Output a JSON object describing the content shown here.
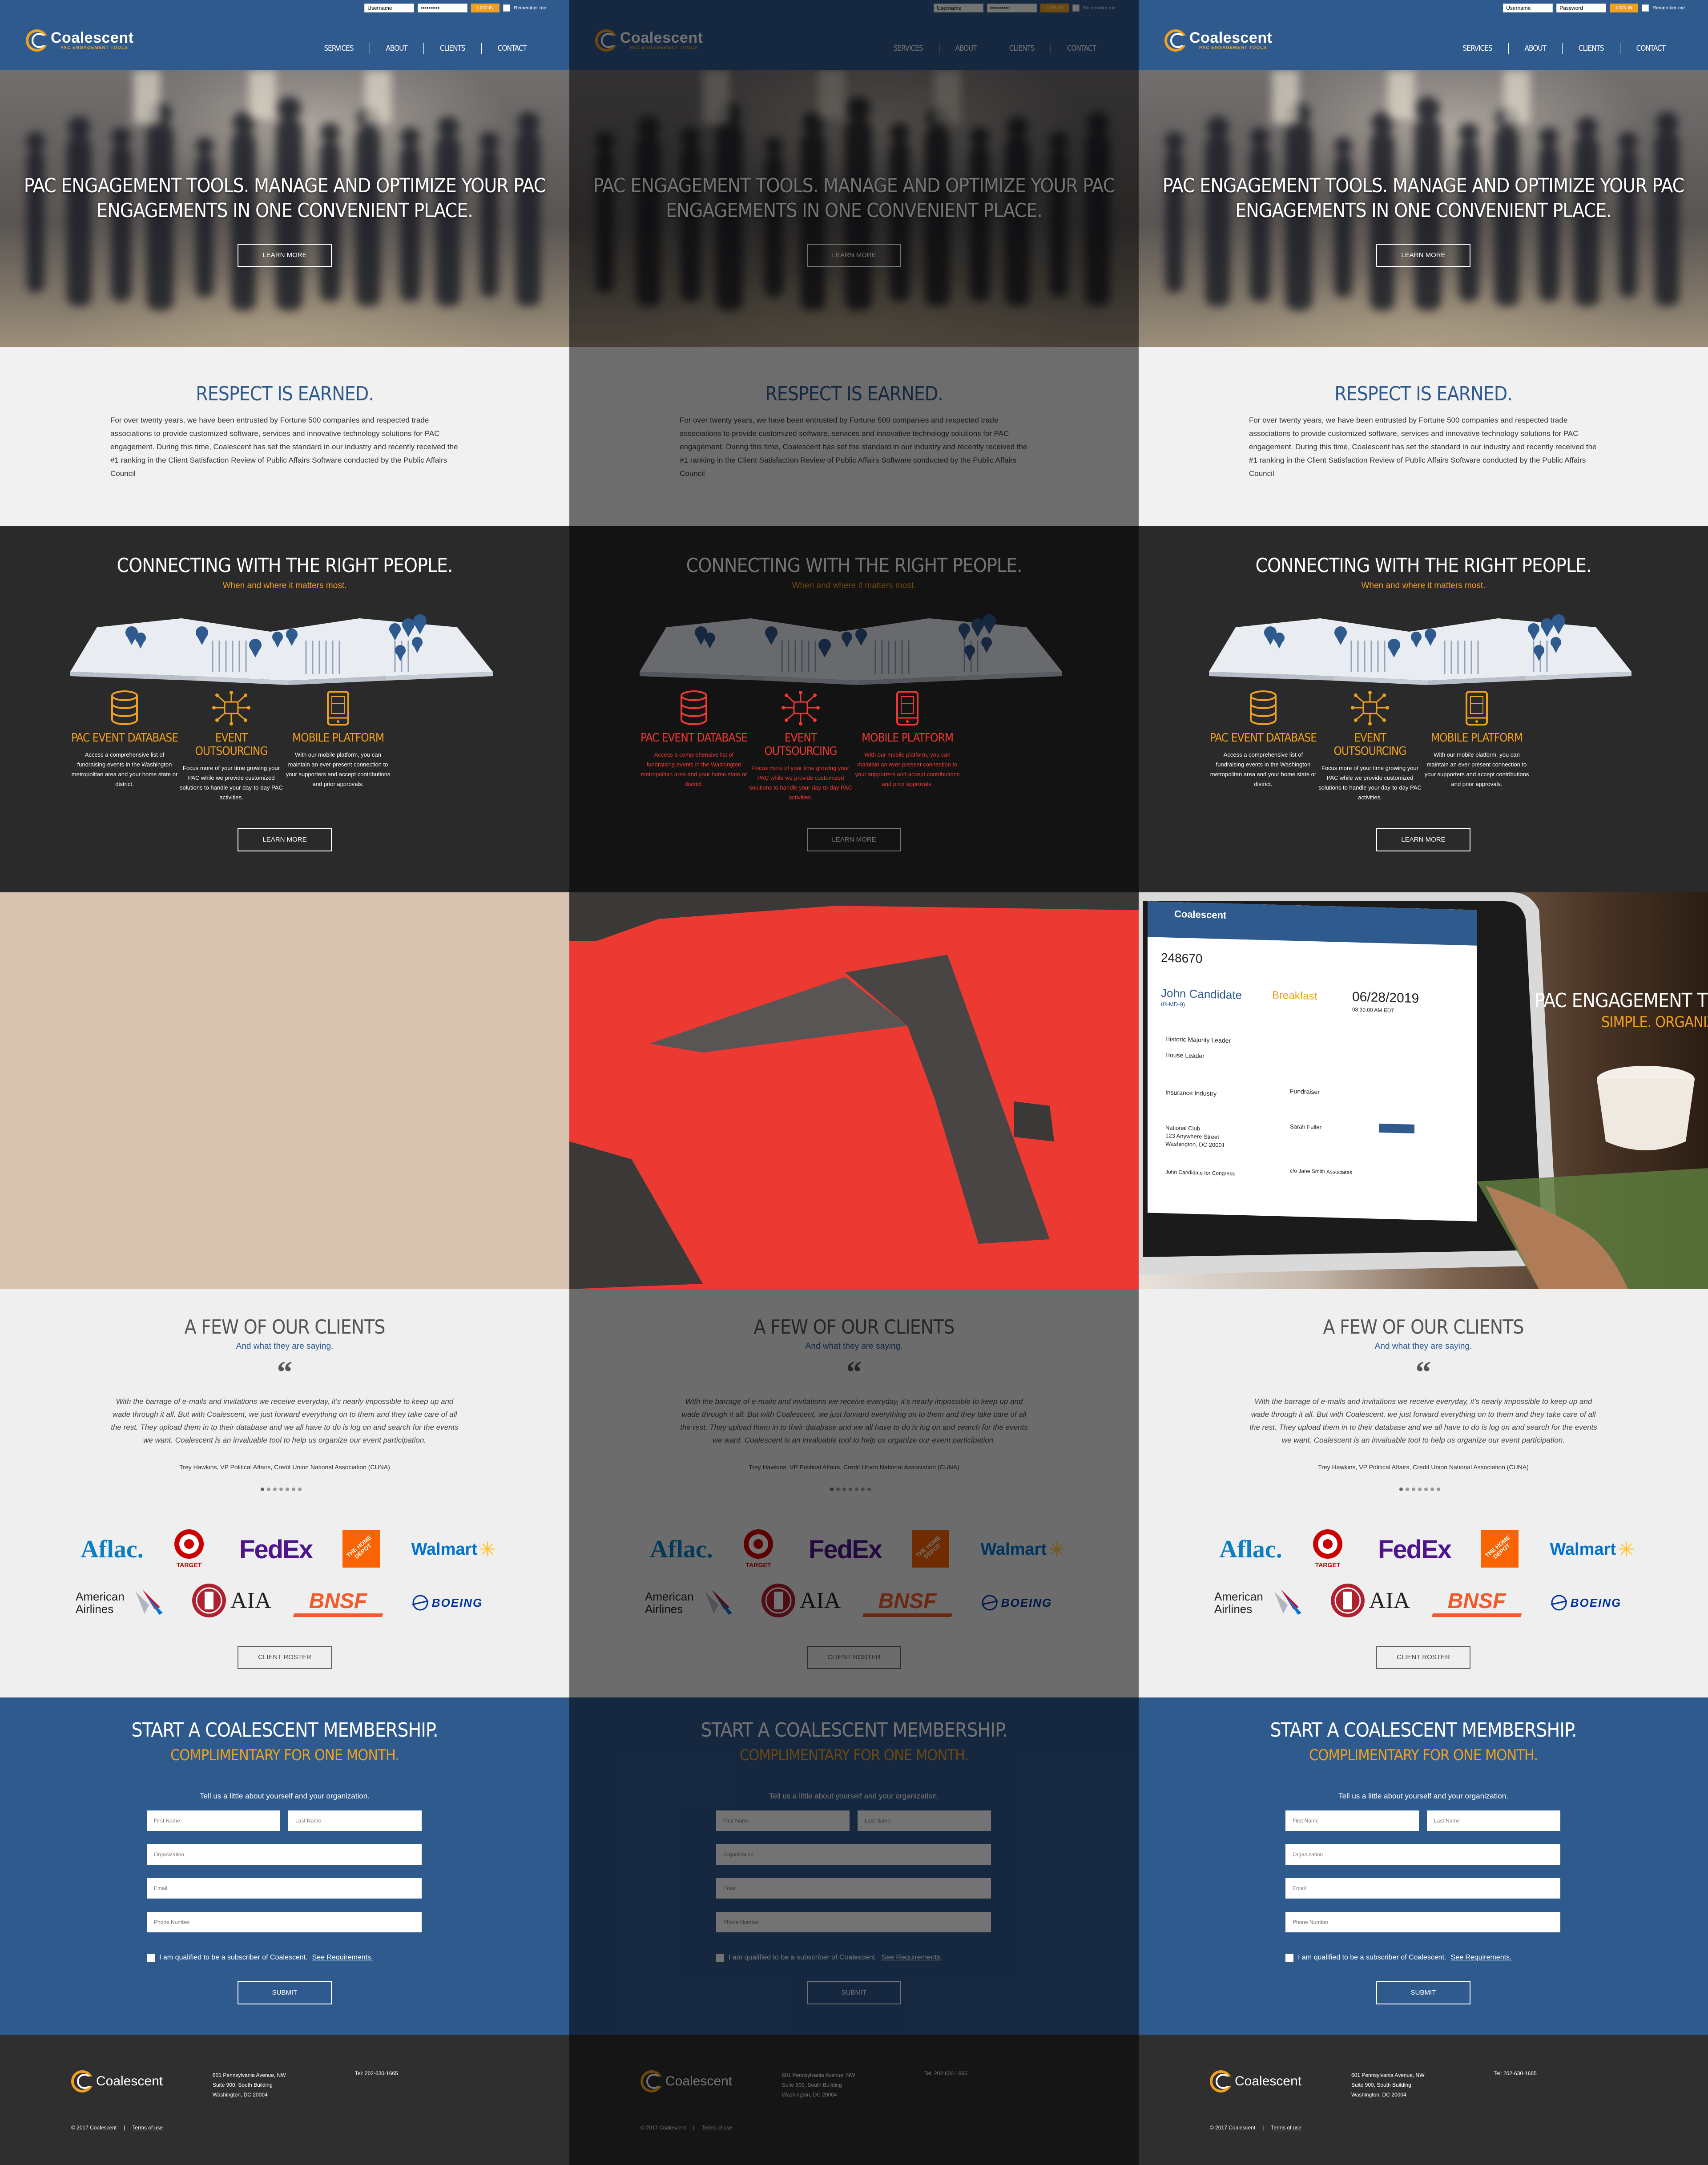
{
  "colors": {
    "brand_blue": "#2f5a8e",
    "accent_orange": "#f0a020",
    "dark": "#2a2a2a",
    "light": "#f1f1f1",
    "highlight_red": "#ec3a32"
  },
  "login": {
    "username_value": "Username",
    "password_value": "••••••••••",
    "password_placeholder": "Password",
    "login_button": "LOG IN",
    "remember": "Remember me"
  },
  "brand": {
    "name": "Coalescent",
    "tagline": "PAC ENGAGEMENT TOOLS"
  },
  "nav": {
    "items": [
      "SERVICES",
      "ABOUT",
      "CLIENTS",
      "CONTACT"
    ]
  },
  "hero": {
    "headline": "PAC ENGAGEMENT TOOLS. MANAGE AND OPTIMIZE YOUR PAC ENGAGEMENTS IN ONE CONVENIENT PLACE.",
    "button": "LEARN MORE"
  },
  "respect": {
    "title": "RESPECT IS EARNED.",
    "body": "For over twenty years, we have been entrusted by Fortune 500 companies and respected trade associations to provide customized software, services and innovative technology solutions for PAC engagement. During this time, Coalescent has set the standard in our industry and recently received the #1 ranking in the Client Satisfaction Review of Public Affairs Software conducted by the Public Affairs Council"
  },
  "connect": {
    "title": "CONNECTING WITH THE RIGHT PEOPLE.",
    "tagline": "When and where it matters most.",
    "features": [
      {
        "title": "PAC EVENT DATABASE",
        "icon": "database-icon",
        "desc": "Access a comprehensive list of fundraising events in the Washington metropolitan area and your home state or district."
      },
      {
        "title": "EVENT OUTSOURCING",
        "icon": "network-icon",
        "desc": "Focus more of your time growing your PAC while we provide customized solutions to handle your day-to-day PAC activities."
      },
      {
        "title": "MOBILE PLATFORM",
        "icon": "mobile-icon",
        "desc": "With our mobile platform, you can maintain an ever-present connection to your supporters and accept contributions and prior approvals."
      }
    ],
    "button": "LEARN MORE"
  },
  "laptop": {
    "headline": "PAC ENGAGEMENT TOOLS",
    "subheadline": "SIMPLE. ORGANIZED",
    "screen": {
      "brand": "Coalescent",
      "event_id": "248670",
      "candidate": "John Candidate",
      "district": "(R-MD-9)",
      "event_type": "Breakfast",
      "date": "06/28/2019",
      "time": "08:30:00 AM EDT",
      "role1": "Historic Majority Leader",
      "role2": "House Leader",
      "industry": "Insurance Industry",
      "type": "Fundraiser",
      "venue": "National Club",
      "venue_addr1": "123 Anywhere Street",
      "venue_addr2": "Washington, DC 20001",
      "contact": "Sarah Fuller",
      "committee": "John Candidate for Congress",
      "host": "c/o Jane Smith Associates"
    }
  },
  "clients": {
    "title": "A FEW OF OUR CLIENTS",
    "tagline": "And what they are saying.",
    "quote": "With the barrage of e-mails and invitations we receive everyday, it's nearly impossible to keep up and wade through it all. But with Coalescent, we just forward everything on to them and they take care of all the rest. They upload them in to their database and we all have to do is log on and search for the events we want. Coalescent is an invaluable tool to help us organize our event participation.",
    "author": "Trey Hawkins, VP Political Affairs, Credit Union National Association (CUNA)",
    "logos": [
      {
        "name": "Aflac",
        "text": "Aflac."
      },
      {
        "name": "Target",
        "text": "TARGET"
      },
      {
        "name": "FedEx",
        "text": "FedEx"
      },
      {
        "name": "The Home Depot",
        "text": "THE HOME DEPOT"
      },
      {
        "name": "Walmart",
        "text": "Walmart"
      },
      {
        "name": "American Airlines",
        "text": "American Airlines"
      },
      {
        "name": "AIA",
        "text": "AIA"
      },
      {
        "name": "BNSF Railway",
        "text": "BNSF"
      },
      {
        "name": "Boeing",
        "text": "BOEING"
      }
    ],
    "button": "CLIENT ROSTER"
  },
  "membership": {
    "title": "START A COALESCENT MEMBERSHIP.",
    "subtitle": "COMPLIMENTARY FOR ONE MONTH.",
    "intro": "Tell us a little about yourself and your organization.",
    "placeholders": {
      "first": "First Name",
      "last": "Last Name",
      "org": "Organization",
      "email": "Email",
      "phone": "Phone Number"
    },
    "checkbox": "I am qualified to be a subscriber of Coalescent.",
    "requirements_link": "See Requirements.",
    "button": "SUBMIT"
  },
  "footer": {
    "brand": "Coalescent",
    "addr1": "601 Pennsylvania Avenue, NW",
    "addr2": "Suite 900, South Building",
    "addr3": "Washington, DC 20004",
    "tel": "Tel: 202-630-1665",
    "copyright": "© 2017 Coalescent",
    "terms": "Terms of use"
  }
}
